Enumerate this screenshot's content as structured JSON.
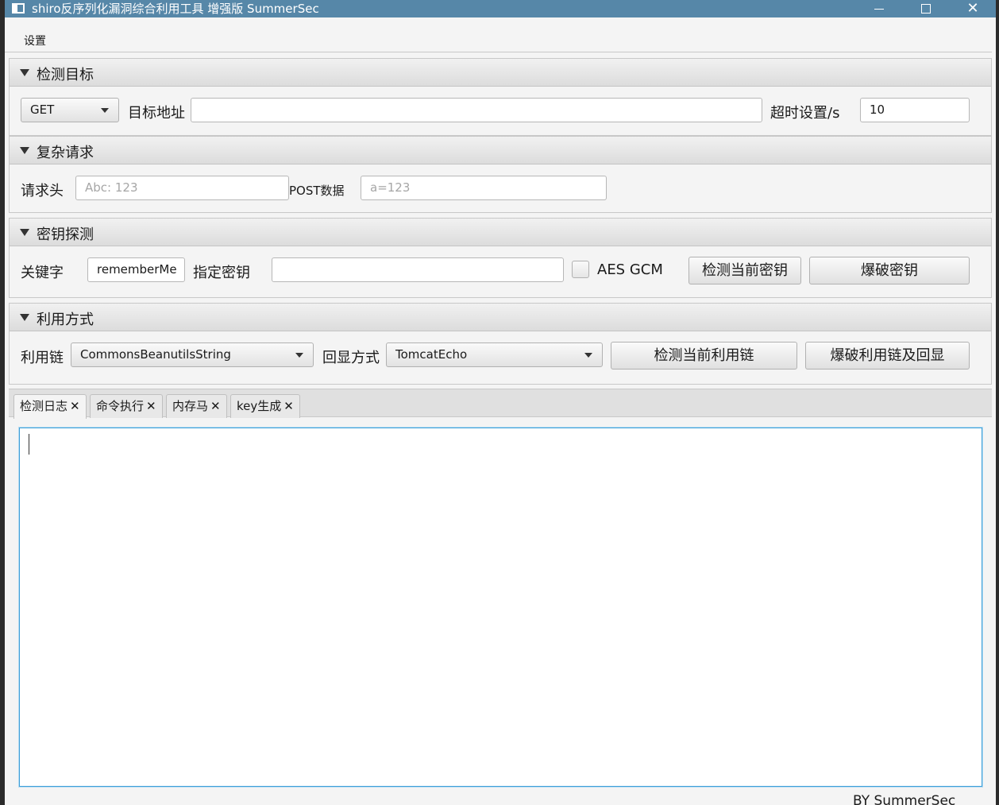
{
  "window": {
    "title": "shiro反序列化漏洞综合利用工具 增强版 SummerSec",
    "minimize": "—",
    "maximize": "□",
    "close": "✕"
  },
  "menu": {
    "settings": "设置"
  },
  "target_pane": {
    "title": "检测目标",
    "method": "GET",
    "url_label": "目标地址",
    "url_value": "",
    "timeout_label": "超时设置/s",
    "timeout_value": "10"
  },
  "complex_pane": {
    "title": "复杂请求",
    "headers_label": "请求头",
    "headers_placeholder": "Abc: 123",
    "post_label": "POST数据",
    "post_placeholder": "a=123"
  },
  "key_pane": {
    "title": "密钥探测",
    "keyword_label": "关键字",
    "keyword_value": "rememberMe",
    "key_label": "指定密钥",
    "key_value": "",
    "aes_gcm_label": "AES GCM",
    "aes_gcm_checked": false,
    "check_key_button": "检测当前密钥",
    "brute_key_button": "爆破密钥"
  },
  "exploit_pane": {
    "title": "利用方式",
    "chain_label": "利用链",
    "chain_value": "CommonsBeanutilsString",
    "echo_label": "回显方式",
    "echo_value": "TomcatEcho",
    "check_chain_button": "检测当前利用链",
    "brute_chain_button": "爆破利用链及回显"
  },
  "tabs": [
    {
      "label": "检测日志",
      "close": "✕",
      "active": true
    },
    {
      "label": "命令执行",
      "close": "✕",
      "active": false
    },
    {
      "label": "内存马",
      "close": "✕",
      "active": false
    },
    {
      "label": "key生成",
      "close": "✕",
      "active": false
    }
  ],
  "log_text": "",
  "footer": "BY   SummerSec",
  "colors": {
    "titlebar": "#5687a8",
    "focus": "#3f9fd8"
  }
}
